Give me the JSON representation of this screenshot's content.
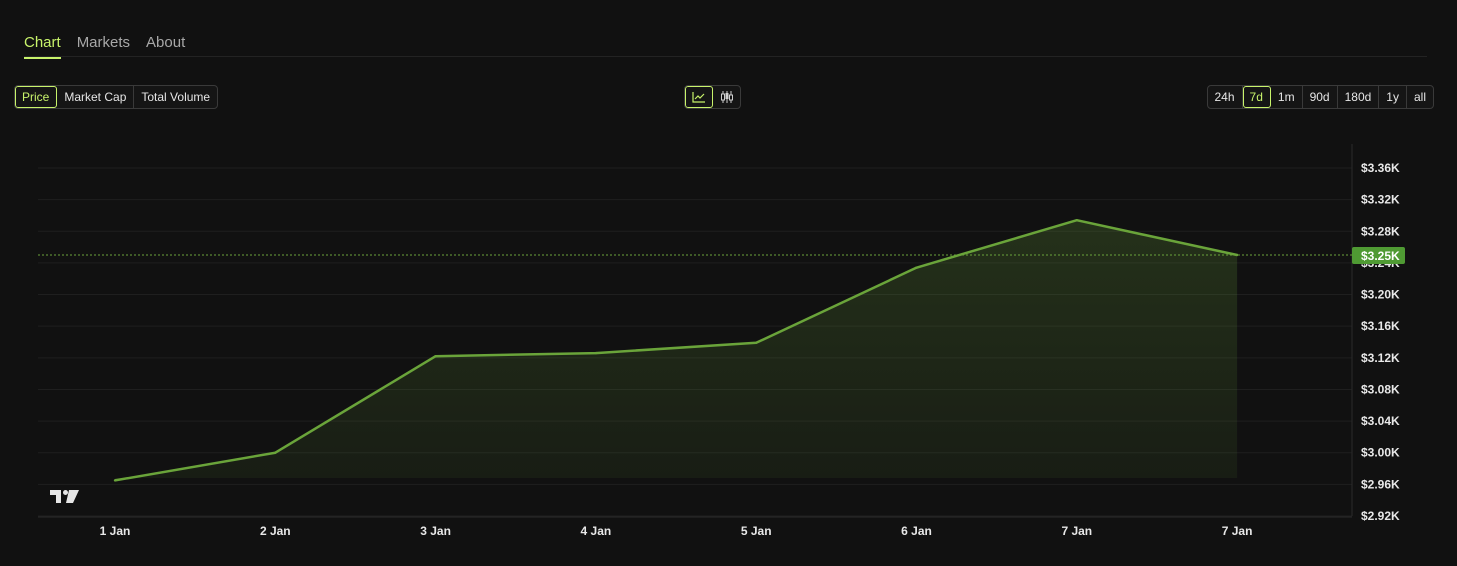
{
  "tabs": [
    {
      "label": "Chart",
      "active": true
    },
    {
      "label": "Markets",
      "active": false
    },
    {
      "label": "About",
      "active": false
    }
  ],
  "metrics": [
    {
      "label": "Price",
      "active": true
    },
    {
      "label": "Market Cap",
      "active": false
    },
    {
      "label": "Total Volume",
      "active": false
    }
  ],
  "chart_type_buttons": [
    {
      "icon": "line-chart-icon",
      "active": true
    },
    {
      "icon": "candlestick-icon",
      "active": false
    }
  ],
  "ranges": [
    {
      "label": "24h",
      "active": false
    },
    {
      "label": "7d",
      "active": true
    },
    {
      "label": "1m",
      "active": false
    },
    {
      "label": "90d",
      "active": false
    },
    {
      "label": "180d",
      "active": false
    },
    {
      "label": "1y",
      "active": false
    },
    {
      "label": "all",
      "active": false
    }
  ],
  "colors": {
    "accent": "#c8f36b",
    "line": "#6aa43a",
    "price_tag": "#4f9a33"
  },
  "chart_data": {
    "type": "area",
    "x": [
      "1 Jan",
      "2 Jan",
      "3 Jan",
      "4 Jan",
      "5 Jan",
      "6 Jan",
      "7 Jan",
      "7 Jan"
    ],
    "series": [
      {
        "values": [
          2965,
          3000,
          3122,
          3126,
          3139,
          3234,
          3294,
          3250
        ]
      }
    ],
    "y_ticks": [
      "$3.36K",
      "$3.32K",
      "$3.28K",
      "$3.24K",
      "$3.20K",
      "$3.16K",
      "$3.12K",
      "$3.08K",
      "$3.04K",
      "$3.00K",
      "$2.96K",
      "$2.92K"
    ],
    "y_tick_values": [
      3360,
      3320,
      3280,
      3240,
      3200,
      3160,
      3120,
      3080,
      3040,
      3000,
      2960,
      2920
    ],
    "ylim": [
      2920,
      3380
    ],
    "current_price_label": "$3.25K",
    "current_price": 3250,
    "grid": true,
    "watermark": "TradingView logo"
  }
}
